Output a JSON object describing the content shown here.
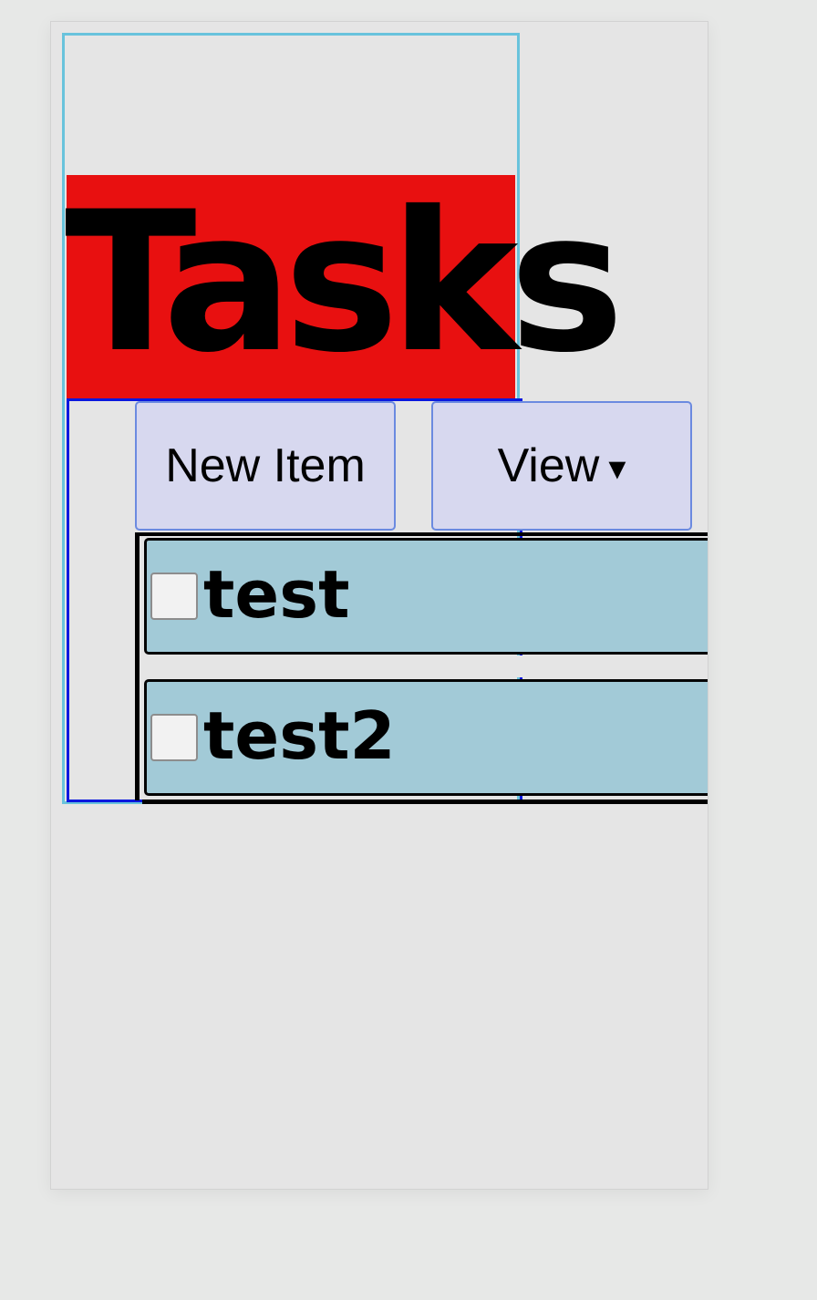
{
  "page": {
    "title": "Tasks"
  },
  "toolbar": {
    "new_item_label": "New Item",
    "view_label": "View",
    "view_caret": "▾"
  },
  "tasks": [
    {
      "label": "test",
      "checked": false
    },
    {
      "label": "test2",
      "checked": false
    }
  ],
  "colors": {
    "title_band": "#e81010",
    "button_bg": "#d7d8ef",
    "button_border": "#6b8ae0",
    "task_bg": "#a2cad7",
    "panel_border": "#0a18de",
    "outer_border": "#69c3dc"
  },
  "icons": {
    "view_dropdown": "chevron-down-icon",
    "task_checkbox": "checkbox-icon"
  }
}
